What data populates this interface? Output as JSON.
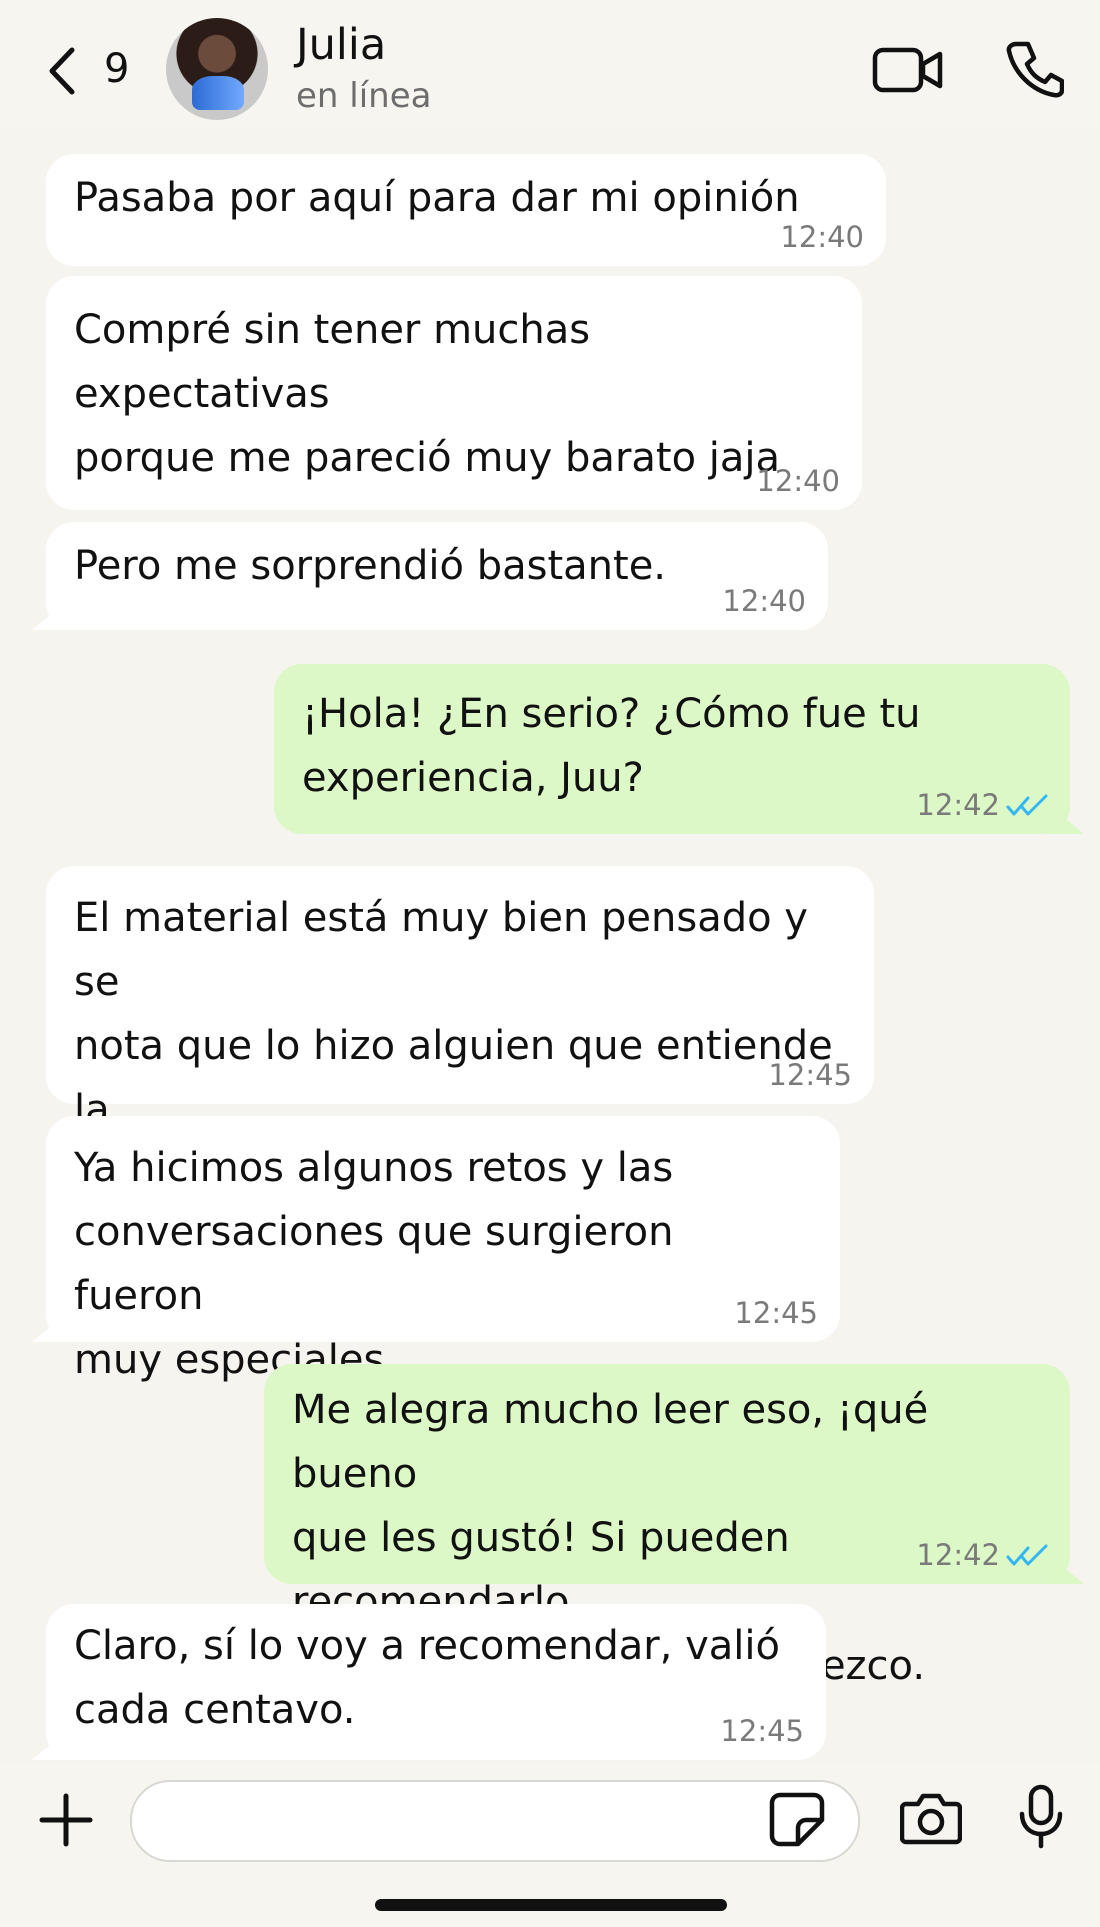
{
  "header": {
    "unread_count": "9",
    "contact_name": "Julia",
    "contact_status": "en línea"
  },
  "messages": [
    {
      "direction": "incoming",
      "text": "Pasaba por aquí para dar mi opinión",
      "time": "12:40"
    },
    {
      "direction": "incoming",
      "text": "Compré sin tener muchas expectativas\nporque me pareció muy barato jaja",
      "time": "12:40"
    },
    {
      "direction": "incoming",
      "text": "Pero me sorprendió bastante.",
      "time": "12:40"
    },
    {
      "direction": "outgoing",
      "text": "¡Hola! ¿En serio? ¿Cómo fue tu\nexperiencia, Juu?",
      "time": "12:42",
      "status": "read"
    },
    {
      "direction": "incoming",
      "text": "El material está muy bien pensado y se\nnota que lo hizo alguien que entiende la\nrealidad de las parejas",
      "time": "12:45"
    },
    {
      "direction": "incoming",
      "text": "Ya hicimos algunos retos y las\nconversaciones que surgieron fueron\nmuy especiales",
      "time": "12:45"
    },
    {
      "direction": "outgoing",
      "text": "Me alegra mucho leer eso, ¡qué bueno\nque les gustó! Si pueden recomendarlo\na más parejas, se lo agradezco.",
      "time": "12:42",
      "status": "read"
    },
    {
      "direction": "incoming",
      "text": "Claro, sí lo voy a recomendar, valió\ncada centavo.",
      "time": "12:45"
    }
  ],
  "composer": {
    "placeholder": ""
  },
  "icons": {
    "back": "chevron-left-icon",
    "video": "video-camera-icon",
    "call": "phone-icon",
    "plus": "plus-icon",
    "sticker": "sticker-icon",
    "camera": "camera-icon",
    "mic": "microphone-icon",
    "read_ticks": "double-check-icon"
  },
  "colors": {
    "background": "#f5f4ef",
    "incoming_bubble": "#ffffff",
    "outgoing_bubble": "#dcf8c6",
    "read_tick": "#34b7f1"
  }
}
